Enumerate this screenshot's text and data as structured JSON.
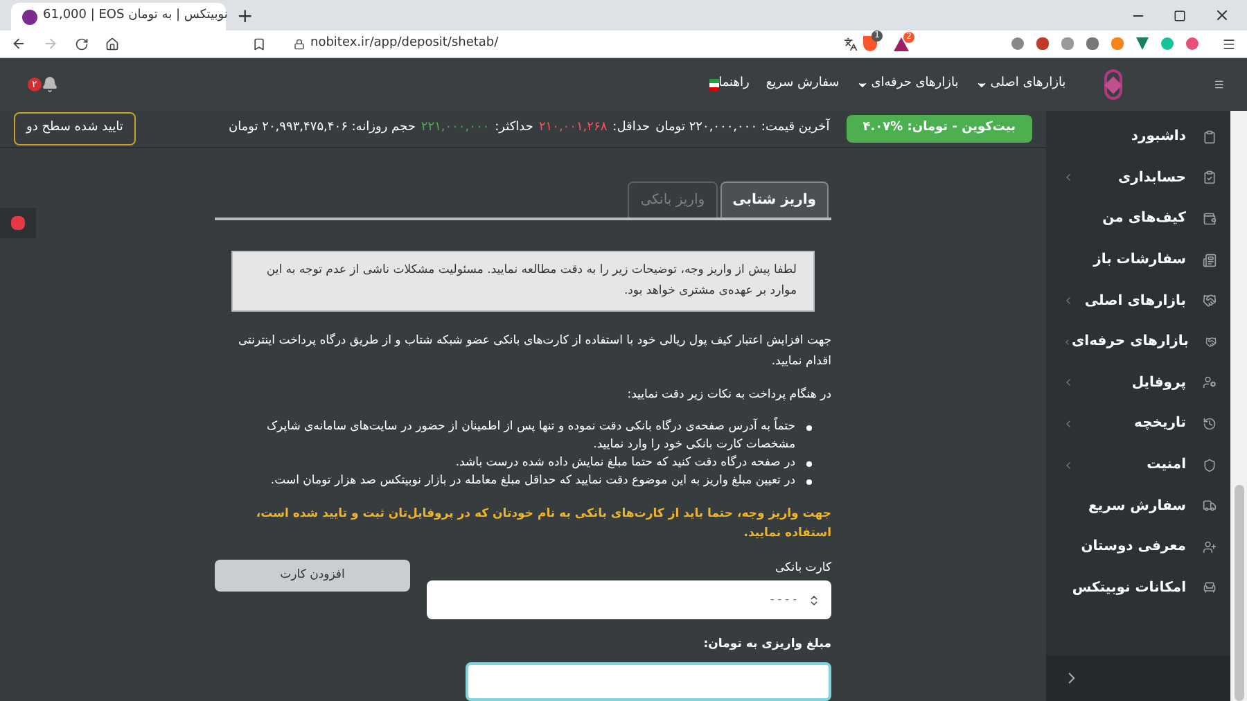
{
  "browser": {
    "tab_title": "61,000 | EOS نوبیتکس | به تومان",
    "new_tab": "+",
    "url": "nobitex.ir/app/deposit/shetab/",
    "brave_count": "1",
    "bat_count": "2"
  },
  "navbar": {
    "links": [
      {
        "label": "بازارهای اصلی",
        "dropdown": true
      },
      {
        "label": "بازارهای حرفه‌ای",
        "dropdown": true
      },
      {
        "label": "سفارش سریع",
        "dropdown": false
      },
      {
        "label": "راهنما",
        "dropdown": false
      }
    ],
    "notifications": "۲"
  },
  "ticker": {
    "market": "بیت‌کوین - تومان: %۴.۰۷",
    "last_price": "آخرین قیمت: ۲۲۰,۰۰۰,۰۰۰ تومان",
    "min_label": "حداقل:",
    "min_value": "۲۱۰,۰۰۱,۲۶۸",
    "max_label": "حداکثر:",
    "max_value": "۲۲۱,۰۰۰,۰۰۰",
    "volume": "حجم روزانه: ۲۰,۹۹۳,۴۷۵,۴۰۶ تومان",
    "level_badge": "تایید شده سطح دو"
  },
  "sidebar": {
    "items": [
      {
        "label": "داشبورد",
        "expandable": false
      },
      {
        "label": "حسابداری",
        "expandable": true
      },
      {
        "label": "کیف‌های من",
        "expandable": false
      },
      {
        "label": "سفارشات باز",
        "expandable": false
      },
      {
        "label": "بازارهای اصلی",
        "expandable": true
      },
      {
        "label": "بازارهای حرفه‌ای",
        "expandable": true
      },
      {
        "label": "پروفایل",
        "expandable": true
      },
      {
        "label": "تاریخچه",
        "expandable": true
      },
      {
        "label": "امنیت",
        "expandable": true
      },
      {
        "label": "سفارش سریع",
        "expandable": false
      },
      {
        "label": "معرفی دوستان",
        "expandable": false
      },
      {
        "label": "امکانات نوبیتکس",
        "expandable": false
      }
    ]
  },
  "deposit": {
    "tabs": [
      {
        "label": "واریز شتابی",
        "selected": true
      },
      {
        "label": "واریز بانکی",
        "selected": false
      }
    ],
    "notice": "لطفا پیش از واریز وجه، توضیحات زیر را به دقت مطالعه نمایید. مسئولیت مشکلات ناشی از عدم توجه به این موارد بر عهده‌ی مشتری خواهد بود.",
    "intro": "جهت افزایش اعتبار کیف پول ریالی خود با استفاده از کارت‌های بانکی عضو شبکه شتاب و از طریق درگاه پرداخت اینترنتی اقدام نمایید.",
    "tips_heading": "در هنگام پرداخت به نکات زیر دقت نمایید:",
    "tips": [
      "حتماً به آدرس صفحه‌ی درگاه بانکی دقت نموده و تنها پس از اطمینان از حضور در سایت‌های سامانه‌ی شاپرک مشخصات کارت بانکی خود را وارد نمایید.",
      "در صفحه درگاه دقت کنید که حتما مبلغ نمایش داده شده درست باشد.",
      "در تعیین مبلغ واریز به این موضوع دقت نمایید که حداقل مبلغ معامله در بازار نوبیتکس صد هزار تومان است."
    ],
    "warning": "جهت واریز وجه، حتما باید از کارت‌های بانکی به نام خودتان که در پروفایل‌تان ثبت و تایید شده است، استفاده نمایید.",
    "card_label": "کارت بانکی",
    "card_value": "- - - -",
    "add_card": "افزودن کارت",
    "amount_label": "مبلغ واریزی به تومان:"
  }
}
